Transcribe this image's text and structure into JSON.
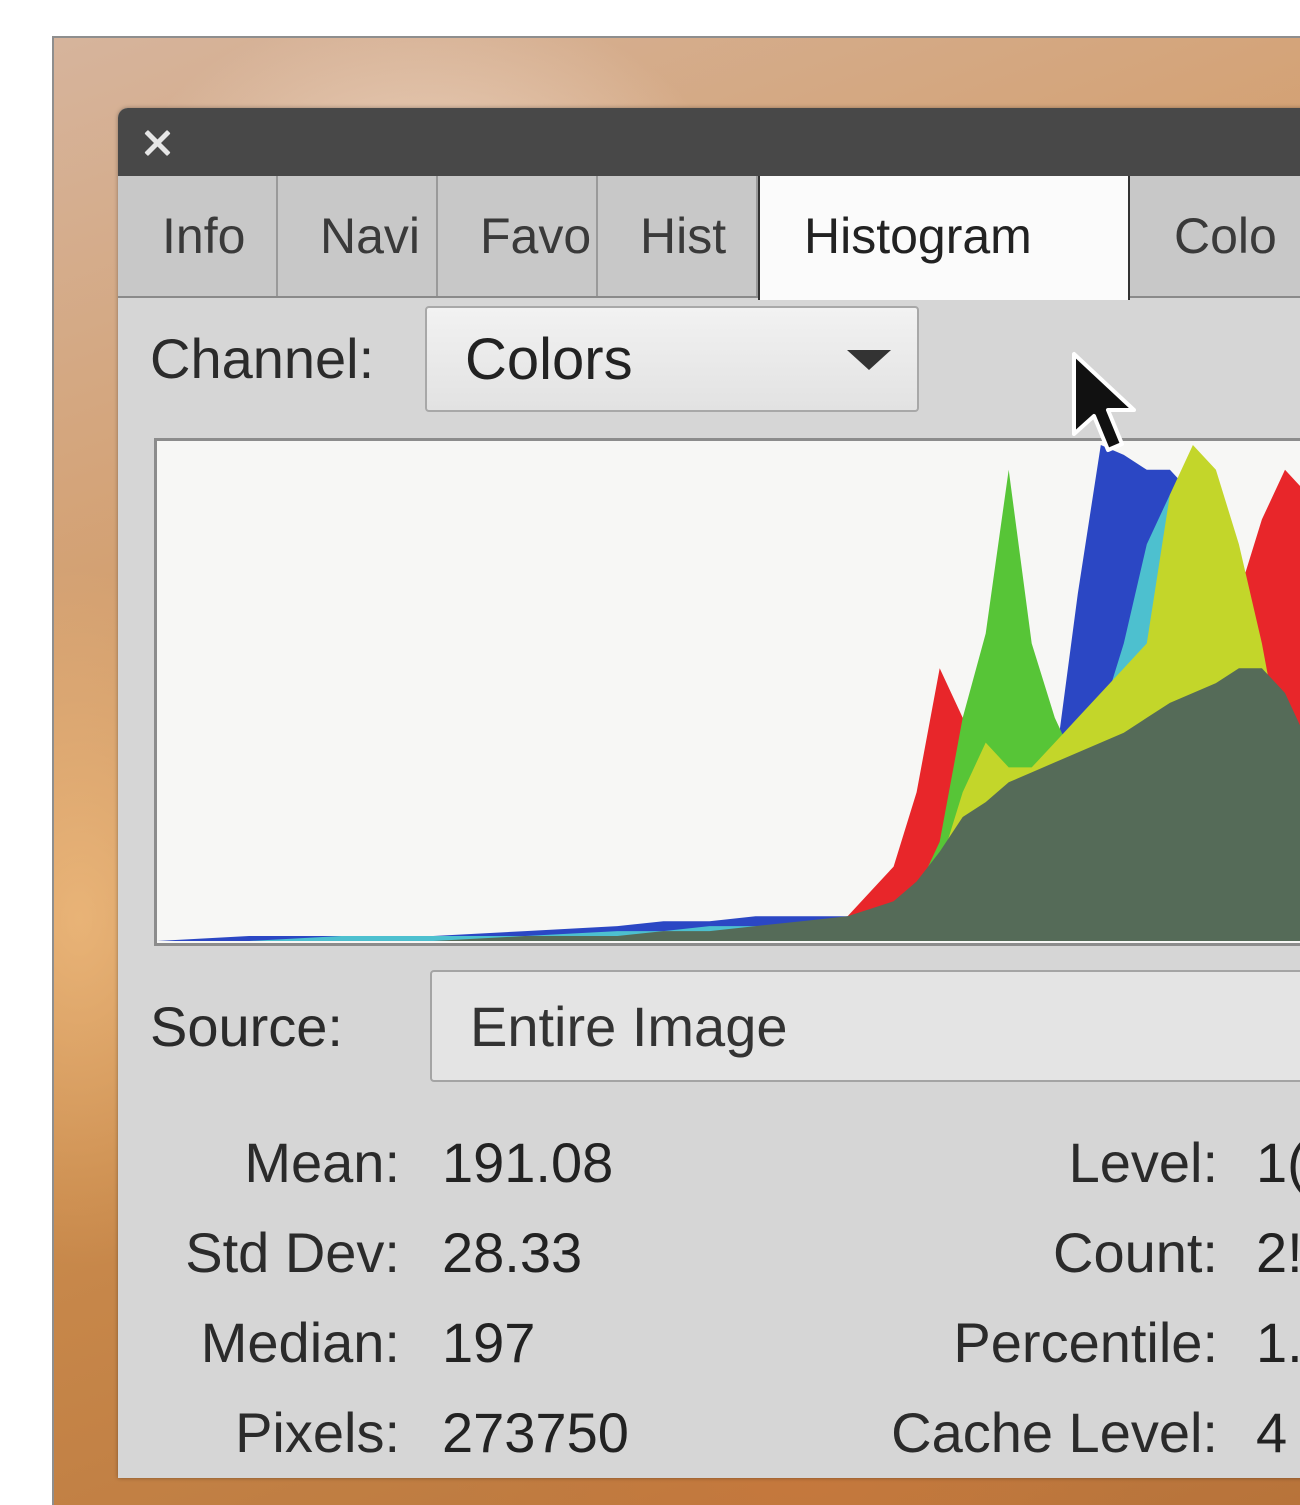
{
  "panel": {
    "close_label": "✕",
    "tabs": [
      "Info",
      "Navi",
      "Favo",
      "Hist",
      "Histogram",
      "Colo"
    ],
    "active_tab": "Histogram"
  },
  "channel": {
    "label": "Channel:",
    "value": "Colors"
  },
  "source": {
    "label": "Source:",
    "value": "Entire Image"
  },
  "stats": {
    "mean_label": "Mean:",
    "mean": "191.08",
    "stddev_label": "Std Dev:",
    "stddev": "28.33",
    "median_label": "Median:",
    "median": "197",
    "pixels_label": "Pixels:",
    "pixels": "273750",
    "level_label": "Level:",
    "level": "1(",
    "count_label": "Count:",
    "count": "2!",
    "percentile_label": "Percentile:",
    "percentile": "1.",
    "cache_label": "Cache Level:",
    "cache": "4"
  },
  "chart_data": {
    "type": "area",
    "title": "",
    "xlabel": "",
    "ylabel": "",
    "xlim": [
      0,
      255
    ],
    "ylim": [
      0,
      100
    ],
    "grid": false,
    "x": [
      0,
      20,
      40,
      60,
      80,
      100,
      110,
      120,
      130,
      140,
      150,
      160,
      165,
      170,
      175,
      180,
      185,
      190,
      195,
      200,
      205,
      210,
      215,
      220,
      225,
      230,
      235,
      240,
      245,
      250,
      255
    ],
    "series": [
      {
        "color": "#e8262a",
        "values": [
          0,
          0,
          0,
          0,
          0,
          0,
          0,
          0,
          1,
          2,
          5,
          15,
          30,
          55,
          45,
          25,
          20,
          22,
          25,
          30,
          35,
          40,
          45,
          50,
          55,
          60,
          70,
          85,
          95,
          90,
          80
        ]
      },
      {
        "color": "#2b47c4",
        "values": [
          0,
          1,
          1,
          1,
          2,
          3,
          4,
          4,
          5,
          5,
          5,
          4,
          4,
          5,
          8,
          15,
          40,
          25,
          35,
          70,
          100,
          98,
          95,
          95,
          90,
          75,
          60,
          40,
          20,
          5,
          0
        ]
      },
      {
        "color": "#4dc0cf",
        "values": [
          0,
          0,
          1,
          1,
          1,
          2,
          2,
          3,
          3,
          3,
          3,
          3,
          4,
          5,
          8,
          15,
          35,
          38,
          40,
          42,
          45,
          60,
          80,
          90,
          80,
          60,
          40,
          20,
          8,
          2,
          0
        ]
      },
      {
        "color": "#57c537",
        "values": [
          0,
          0,
          0,
          0,
          0,
          0,
          0,
          0,
          0,
          1,
          2,
          5,
          10,
          20,
          45,
          62,
          95,
          60,
          45,
          35,
          25,
          20,
          18,
          15,
          12,
          8,
          5,
          3,
          1,
          0,
          0
        ]
      },
      {
        "color": "#c3d62a",
        "values": [
          0,
          0,
          0,
          0,
          0,
          0,
          0,
          0,
          0,
          1,
          2,
          4,
          8,
          15,
          30,
          40,
          35,
          35,
          40,
          45,
          50,
          55,
          60,
          90,
          100,
          95,
          80,
          60,
          35,
          15,
          5
        ]
      },
      {
        "color": "#556b58",
        "values": [
          0,
          0,
          0,
          0,
          1,
          1,
          2,
          2,
          3,
          4,
          5,
          8,
          12,
          18,
          25,
          28,
          32,
          34,
          36,
          38,
          40,
          42,
          45,
          48,
          50,
          52,
          55,
          55,
          50,
          40,
          30
        ]
      }
    ]
  }
}
